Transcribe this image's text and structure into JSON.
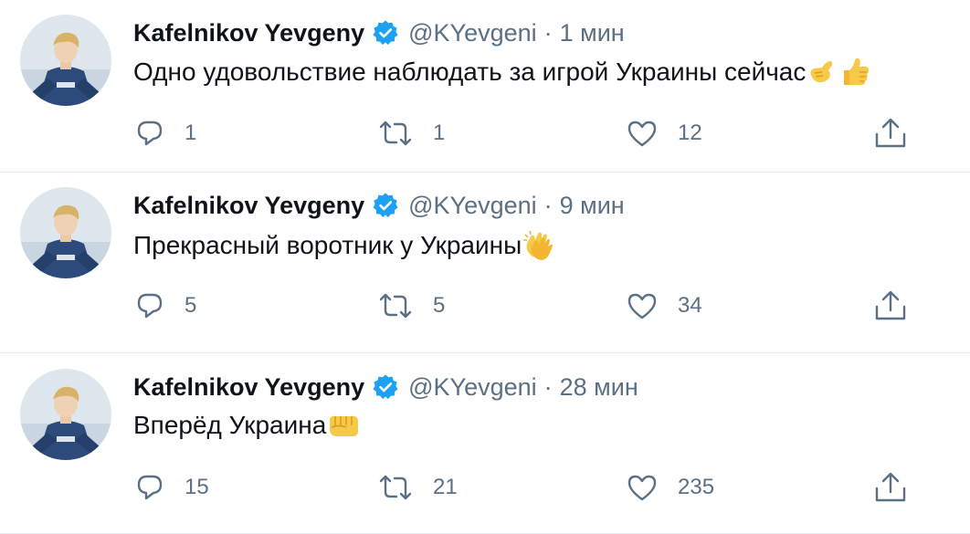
{
  "colors": {
    "text": "#0f1419",
    "secondary": "#5b7083",
    "verified": "#1da1f2",
    "divider": "#e6ecf0"
  },
  "tweets": [
    {
      "name": "Kafelnikov Yevgeny",
      "handle": "@KYevgeni",
      "separator": "·",
      "time": "1 мин",
      "text": "Одно удовольствие наблюдать за игрой Украины сейчас",
      "emojis": [
        "call-me-hand",
        "thumbs-up"
      ],
      "replies": "1",
      "retweets": "1",
      "likes": "12"
    },
    {
      "name": "Kafelnikov Yevgeny",
      "handle": "@KYevgeni",
      "separator": "·",
      "time": "9 мин",
      "text": "Прекрасный воротник у Украины",
      "emojis": [
        "clapping-hands"
      ],
      "replies": "5",
      "retweets": "5",
      "likes": "34"
    },
    {
      "name": "Kafelnikov Yevgeny",
      "handle": "@KYevgeni",
      "separator": "·",
      "time": "28 мин",
      "text": "Вперёд Украина",
      "emojis": [
        "oncoming-fist"
      ],
      "replies": "15",
      "retweets": "21",
      "likes": "235"
    }
  ],
  "icons": {
    "reply": "reply-icon",
    "retweet": "retweet-icon",
    "like": "heart-icon",
    "share": "share-icon",
    "verified": "verified-badge-icon"
  }
}
